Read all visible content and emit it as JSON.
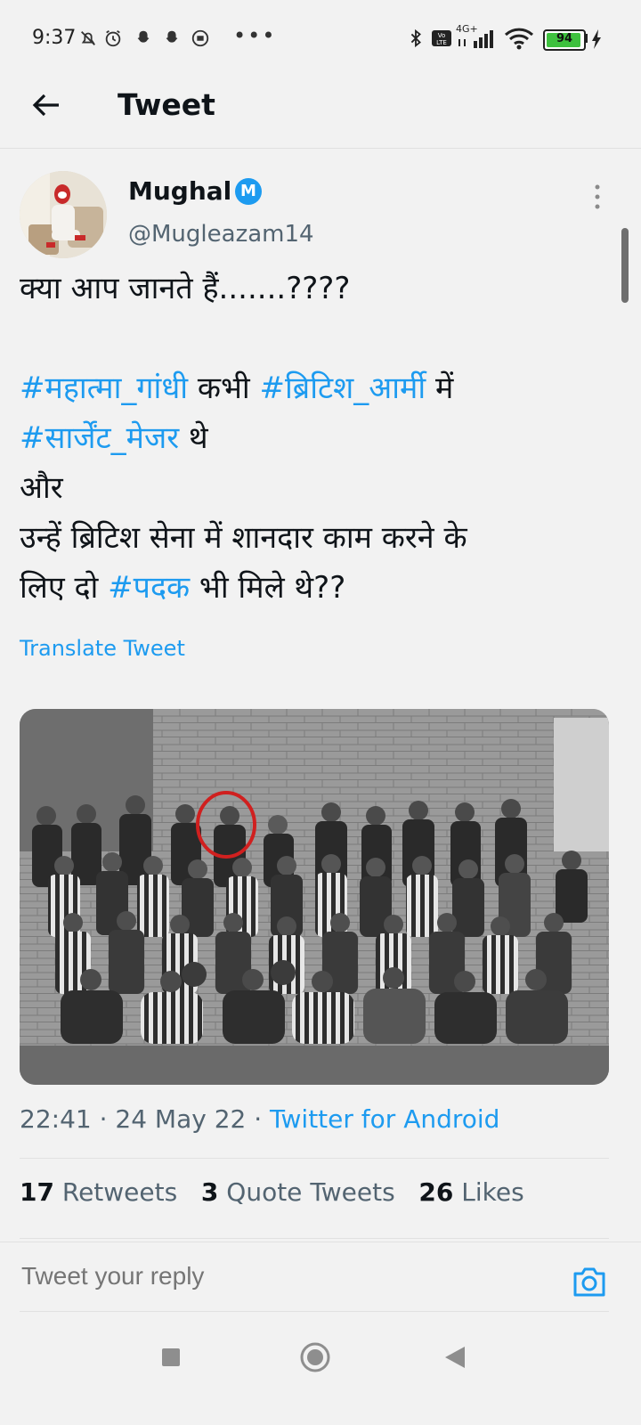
{
  "status_bar": {
    "time": "9:37",
    "overflow": "•••",
    "battery": "94",
    "network": "4G+",
    "icons": [
      "mute-icon",
      "alarm-icon",
      "snapchat-icon",
      "snapchat-icon",
      "app-icon",
      "bluetooth-icon",
      "volte-icon",
      "signal-icon",
      "wifi-icon",
      "battery-icon",
      "charging-icon"
    ]
  },
  "header": {
    "title": "Tweet"
  },
  "tweet": {
    "author_name": "Mughal",
    "verified_badge": "M",
    "handle": "@Mugleazam14",
    "line1": "क्या आप जानते हैं.......????",
    "line2_tag1": "#महात्मा_गांधी",
    "line2_text": " कभी ",
    "line2_tag2": "#ब्रिटिश_आर्मी",
    "line2_end": " में",
    "line3_tag": "#सार्जेंट_मेजर",
    "line3_text": " थे",
    "line4": "और",
    "line5": "उन्हें ब्रिटिश सेना में शानदार काम करने के",
    "line6_start": "लिए दो ",
    "line6_tag": "#पदक",
    "line6_end": " भी मिले थे??",
    "translate": "Translate Tweet",
    "timestamp": "22:41 · 24 May 22 · ",
    "source": "Twitter for Android"
  },
  "stats": {
    "retweets_count": "17",
    "retweets_label": " Retweets",
    "quotes_count": "3",
    "quotes_label": " Quote Tweets",
    "likes_count": "26",
    "likes_label": " Likes"
  },
  "reply": {
    "placeholder": "Tweet your reply"
  },
  "colors": {
    "accent": "#1d9bf0",
    "text": "#0f1419",
    "secondary": "#536471",
    "background": "#f2f2f2"
  }
}
